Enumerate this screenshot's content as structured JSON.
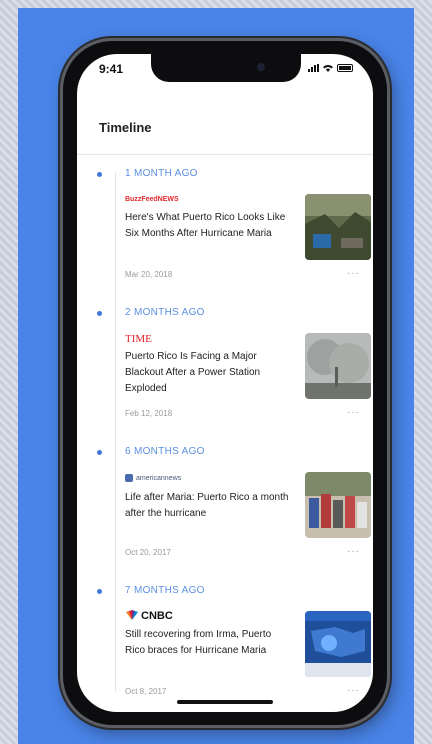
{
  "status_bar": {
    "time": "9:41"
  },
  "header": {
    "title": "Timeline"
  },
  "entries": [
    {
      "ago": "1 MONTH AGO",
      "source": "BuzzFeedNEWS",
      "source_color": "#e3292e",
      "headline": "Here's What Puerto Rico Looks Like Six Months After Hurricane Maria",
      "date": "Mar 20, 2018",
      "more": "···",
      "thumb_icon": "storm-damage-photo"
    },
    {
      "ago": "2 MONTHS AGO",
      "source": "TIME",
      "source_color": "#e31f26",
      "headline": "Puerto Rico Is Facing a Major Blackout After a Power Station Exploded",
      "date": "Feb 12, 2018",
      "more": "···",
      "thumb_icon": "smoke-photo"
    },
    {
      "ago": "6 MONTHS AGO",
      "source": "americannews",
      "source_color": "#4a5a78",
      "headline": "Life after Maria: Puerto Rico a month after the hurricane",
      "date": "Oct 20, 2017",
      "more": "···",
      "thumb_icon": "crowd-photo"
    },
    {
      "ago": "7 MONTHS AGO",
      "source": "CNBC",
      "source_color": "#111111",
      "headline": "Still recovering from Irma, Puerto Rico braces for Hurricane Maria",
      "date": "Oct 8, 2017",
      "more": "···",
      "thumb_icon": "weather-map-photo"
    }
  ]
}
